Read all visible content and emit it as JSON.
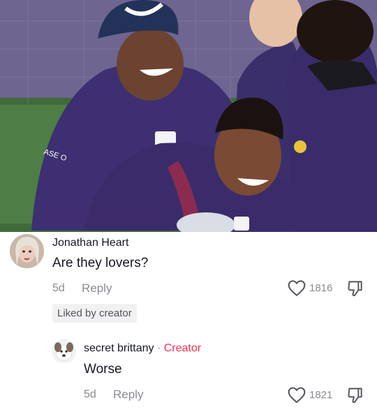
{
  "comments": [
    {
      "author": "Jonathan Heart",
      "text": "Are they lovers?",
      "age": "5d",
      "reply_label": "Reply",
      "like_count": "1816",
      "liked_by_label": "Liked by creator"
    },
    {
      "author": "secret brittany",
      "separator": "·",
      "creator_tag": "Creator",
      "text": "Worse",
      "age": "5d",
      "reply_label": "Reply",
      "like_count": "1821"
    }
  ],
  "icons": {
    "like": "heart-outline-icon",
    "dislike": "thumbs-down-outline-icon"
  },
  "colors": {
    "creator_accent": "#fe2c55",
    "meta_gray": "#8a8b91"
  }
}
